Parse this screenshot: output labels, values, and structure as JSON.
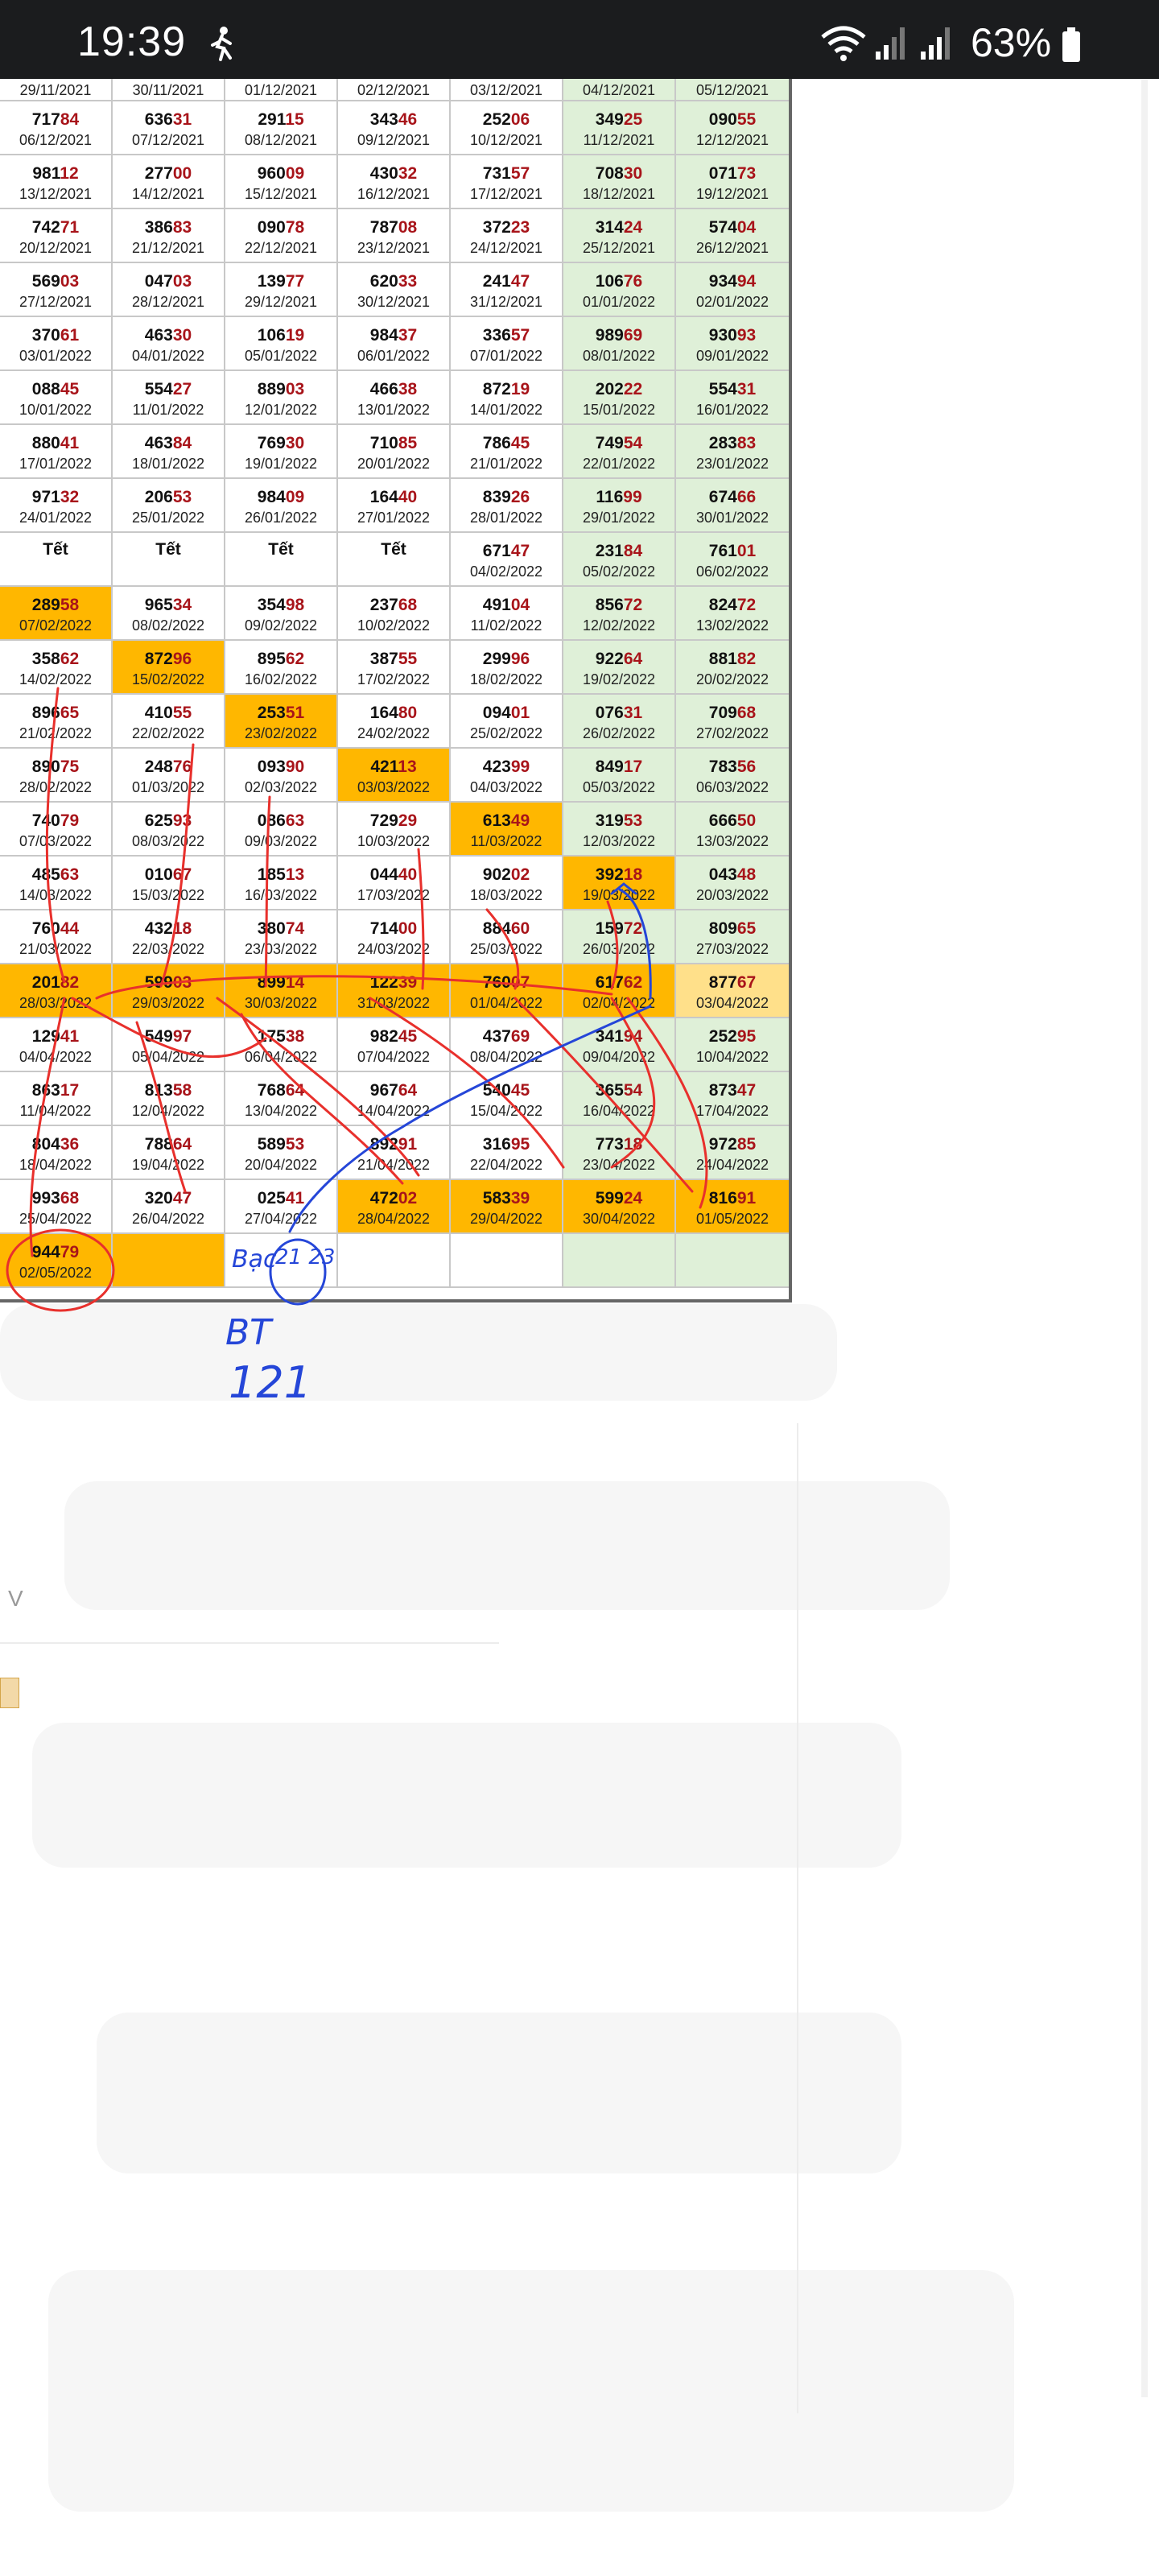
{
  "status_bar": {
    "time": "19:39",
    "battery_percent": "63%",
    "icons": [
      "person-walking-icon",
      "wifi-icon",
      "signal-icon",
      "signal-icon",
      "battery-icon"
    ]
  },
  "table": {
    "rows": [
      [
        [
          "",
          "29/11/2021"
        ],
        [
          "",
          "30/11/2021"
        ],
        [
          "",
          "01/12/2021"
        ],
        [
          "",
          "02/12/2021"
        ],
        [
          "",
          "03/12/2021"
        ],
        [
          "",
          "04/12/2021"
        ],
        [
          "",
          "05/12/2021"
        ]
      ],
      [
        [
          "71784",
          "06/12/2021"
        ],
        [
          "63631",
          "07/12/2021"
        ],
        [
          "29115",
          "08/12/2021"
        ],
        [
          "34346",
          "09/12/2021"
        ],
        [
          "25206",
          "10/12/2021"
        ],
        [
          "34925",
          "11/12/2021"
        ],
        [
          "09055",
          "12/12/2021"
        ]
      ],
      [
        [
          "98112",
          "13/12/2021"
        ],
        [
          "27700",
          "14/12/2021"
        ],
        [
          "96009",
          "15/12/2021"
        ],
        [
          "43032",
          "16/12/2021"
        ],
        [
          "73157",
          "17/12/2021"
        ],
        [
          "70830",
          "18/12/2021"
        ],
        [
          "07173",
          "19/12/2021"
        ]
      ],
      [
        [
          "74271",
          "20/12/2021"
        ],
        [
          "38683",
          "21/12/2021"
        ],
        [
          "09078",
          "22/12/2021"
        ],
        [
          "78708",
          "23/12/2021"
        ],
        [
          "37223",
          "24/12/2021"
        ],
        [
          "31424",
          "25/12/2021"
        ],
        [
          "57404",
          "26/12/2021"
        ]
      ],
      [
        [
          "56903",
          "27/12/2021"
        ],
        [
          "04703",
          "28/12/2021"
        ],
        [
          "13977",
          "29/12/2021"
        ],
        [
          "62033",
          "30/12/2021"
        ],
        [
          "24147",
          "31/12/2021"
        ],
        [
          "10676",
          "01/01/2022"
        ],
        [
          "93494",
          "02/01/2022"
        ]
      ],
      [
        [
          "37061",
          "03/01/2022"
        ],
        [
          "46330",
          "04/01/2022"
        ],
        [
          "10619",
          "05/01/2022"
        ],
        [
          "98437",
          "06/01/2022"
        ],
        [
          "33657",
          "07/01/2022"
        ],
        [
          "98969",
          "08/01/2022"
        ],
        [
          "93093",
          "09/01/2022"
        ]
      ],
      [
        [
          "08845",
          "10/01/2022"
        ],
        [
          "55427",
          "11/01/2022"
        ],
        [
          "88903",
          "12/01/2022"
        ],
        [
          "46638",
          "13/01/2022"
        ],
        [
          "87219",
          "14/01/2022"
        ],
        [
          "20222",
          "15/01/2022"
        ],
        [
          "55431",
          "16/01/2022"
        ]
      ],
      [
        [
          "88041",
          "17/01/2022"
        ],
        [
          "46384",
          "18/01/2022"
        ],
        [
          "76930",
          "19/01/2022"
        ],
        [
          "71085",
          "20/01/2022"
        ],
        [
          "78645",
          "21/01/2022"
        ],
        [
          "74954",
          "22/01/2022"
        ],
        [
          "28383",
          "23/01/2022"
        ]
      ],
      [
        [
          "97132",
          "24/01/2022"
        ],
        [
          "20653",
          "25/01/2022"
        ],
        [
          "98409",
          "26/01/2022"
        ],
        [
          "16440",
          "27/01/2022"
        ],
        [
          "83926",
          "28/01/2022"
        ],
        [
          "11699",
          "29/01/2022"
        ],
        [
          "67466",
          "30/01/2022"
        ]
      ],
      [
        [
          "Tết",
          ""
        ],
        [
          "Tết",
          ""
        ],
        [
          "Tết",
          ""
        ],
        [
          "Tết",
          ""
        ],
        [
          "67147",
          "04/02/2022"
        ],
        [
          "23184",
          "05/02/2022"
        ],
        [
          "76101",
          "06/02/2022"
        ]
      ],
      [
        [
          "28958",
          "07/02/2022"
        ],
        [
          "96534",
          "08/02/2022"
        ],
        [
          "35498",
          "09/02/2022"
        ],
        [
          "23768",
          "10/02/2022"
        ],
        [
          "49104",
          "11/02/2022"
        ],
        [
          "85672",
          "12/02/2022"
        ],
        [
          "82472",
          "13/02/2022"
        ]
      ],
      [
        [
          "35862",
          "14/02/2022"
        ],
        [
          "87296",
          "15/02/2022"
        ],
        [
          "89562",
          "16/02/2022"
        ],
        [
          "38755",
          "17/02/2022"
        ],
        [
          "29996",
          "18/02/2022"
        ],
        [
          "92264",
          "19/02/2022"
        ],
        [
          "88182",
          "20/02/2022"
        ]
      ],
      [
        [
          "89665",
          "21/02/2022"
        ],
        [
          "41055",
          "22/02/2022"
        ],
        [
          "25351",
          "23/02/2022"
        ],
        [
          "16480",
          "24/02/2022"
        ],
        [
          "09401",
          "25/02/2022"
        ],
        [
          "07631",
          "26/02/2022"
        ],
        [
          "70968",
          "27/02/2022"
        ]
      ],
      [
        [
          "89075",
          "28/02/2022"
        ],
        [
          "24876",
          "01/03/2022"
        ],
        [
          "09390",
          "02/03/2022"
        ],
        [
          "42113",
          "03/03/2022"
        ],
        [
          "42399",
          "04/03/2022"
        ],
        [
          "84917",
          "05/03/2022"
        ],
        [
          "78356",
          "06/03/2022"
        ]
      ],
      [
        [
          "74079",
          "07/03/2022"
        ],
        [
          "62593",
          "08/03/2022"
        ],
        [
          "08663",
          "09/03/2022"
        ],
        [
          "72929",
          "10/03/2022"
        ],
        [
          "61349",
          "11/03/2022"
        ],
        [
          "31953",
          "12/03/2022"
        ],
        [
          "66650",
          "13/03/2022"
        ]
      ],
      [
        [
          "48563",
          "14/03/2022"
        ],
        [
          "01067",
          "15/03/2022"
        ],
        [
          "18513",
          "16/03/2022"
        ],
        [
          "04440",
          "17/03/2022"
        ],
        [
          "90202",
          "18/03/2022"
        ],
        [
          "39218",
          "19/03/2022"
        ],
        [
          "04348",
          "20/03/2022"
        ]
      ],
      [
        [
          "76044",
          "21/03/2022"
        ],
        [
          "43218",
          "22/03/2022"
        ],
        [
          "38074",
          "23/03/2022"
        ],
        [
          "71400",
          "24/03/2022"
        ],
        [
          "88460",
          "25/03/2022"
        ],
        [
          "15972",
          "26/03/2022"
        ],
        [
          "80965",
          "27/03/2022"
        ]
      ],
      [
        [
          "20182",
          "28/03/2022"
        ],
        [
          "59903",
          "29/03/2022"
        ],
        [
          "89914",
          "30/03/2022"
        ],
        [
          "12239",
          "31/03/2022"
        ],
        [
          "76007",
          "01/04/2022"
        ],
        [
          "61762",
          "02/04/2022"
        ],
        [
          "87767",
          "03/04/2022"
        ]
      ],
      [
        [
          "12941",
          "04/04/2022"
        ],
        [
          "54997",
          "05/04/2022"
        ],
        [
          "17538",
          "06/04/2022"
        ],
        [
          "98245",
          "07/04/2022"
        ],
        [
          "43769",
          "08/04/2022"
        ],
        [
          "34194",
          "09/04/2022"
        ],
        [
          "25295",
          "10/04/2022"
        ]
      ],
      [
        [
          "86317",
          "11/04/2022"
        ],
        [
          "81358",
          "12/04/2022"
        ],
        [
          "76864",
          "13/04/2022"
        ],
        [
          "96764",
          "14/04/2022"
        ],
        [
          "54045",
          "15/04/2022"
        ],
        [
          "36554",
          "16/04/2022"
        ],
        [
          "87347",
          "17/04/2022"
        ]
      ],
      [
        [
          "80436",
          "18/04/2022"
        ],
        [
          "78864",
          "19/04/2022"
        ],
        [
          "58953",
          "20/04/2022"
        ],
        [
          "89291",
          "21/04/2022"
        ],
        [
          "31695",
          "22/04/2022"
        ],
        [
          "77318",
          "23/04/2022"
        ],
        [
          "97285",
          "24/04/2022"
        ]
      ],
      [
        [
          "99368",
          "25/04/2022"
        ],
        [
          "32047",
          "26/04/2022"
        ],
        [
          "02541",
          "27/04/2022"
        ],
        [
          "47202",
          "28/04/2022"
        ],
        [
          "58339",
          "29/04/2022"
        ],
        [
          "59924",
          "30/04/2022"
        ],
        [
          "81691",
          "01/05/2022"
        ]
      ],
      [
        [
          "94479",
          "02/05/2022"
        ],
        [
          "",
          ""
        ],
        [
          "",
          ""
        ],
        [
          "",
          ""
        ],
        [
          "",
          ""
        ],
        [
          "",
          ""
        ],
        [
          "",
          ""
        ]
      ]
    ],
    "highlighted_cells": [
      [
        10,
        0
      ],
      [
        11,
        1
      ],
      [
        12,
        2
      ],
      [
        13,
        3
      ],
      [
        14,
        4
      ],
      [
        15,
        5
      ],
      [
        21,
        3
      ],
      [
        21,
        4
      ],
      [
        21,
        5
      ],
      [
        21,
        6
      ],
      [
        22,
        0
      ],
      [
        22,
        1
      ]
    ],
    "highlighted_row": 17,
    "light_highlight_cells": [
      [
        17,
        6
      ]
    ],
    "colors": {
      "highlight": "#ffb700",
      "light_highlight": "#ffe08a",
      "weekend": "#dff0d8",
      "tail_digits": "#a8141a",
      "red_ink": "#e8302c",
      "blue_ink": "#2546d8"
    }
  },
  "annotations": {
    "blue_label_1": "Bạc",
    "blue_circle_text": "21 23",
    "blue_label_2": "BT",
    "blue_label_3": "121"
  },
  "below_content": {
    "partial_letter": "V"
  }
}
